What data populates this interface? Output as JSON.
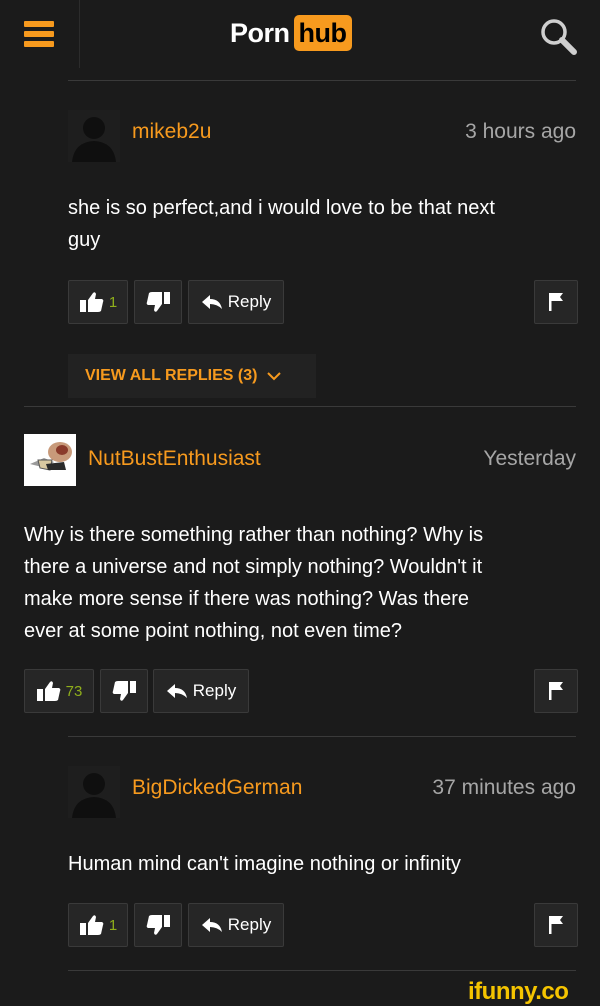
{
  "header": {
    "logo_left": "Porn",
    "logo_right": "hub",
    "menu_icon": "hamburger-menu-icon",
    "search_icon": "search-icon"
  },
  "comments": [
    {
      "username": "mikeb2u",
      "time": "3 hours ago",
      "text_lines": [
        "she is so perfect,and i would love to be that next",
        "guy"
      ],
      "likes": "1",
      "reply_label": "Reply"
    },
    {
      "username": "NutBustEnthusiast",
      "time": "Yesterday",
      "text_lines": [
        "Why is there something rather than nothing? Why is",
        "there a universe and not simply nothing? Wouldn't it",
        "make more sense if there was nothing? Was there",
        "ever at some point nothing, not even time?"
      ],
      "likes": "73",
      "reply_label": "Reply"
    },
    {
      "username": "BigDickedGerman",
      "time": "37 minutes ago",
      "text_lines": [
        "Human mind can't imagine nothing or infinity"
      ],
      "likes": "1",
      "reply_label": "Reply"
    }
  ],
  "view_replies": {
    "label": "VIEW ALL REPLIES (3)"
  },
  "watermark": "ifunny.co",
  "colors": {
    "accent": "#f79a1e",
    "background": "#1b1b1b",
    "likes": "#8fae1b",
    "muted": "#a6a6a6"
  }
}
